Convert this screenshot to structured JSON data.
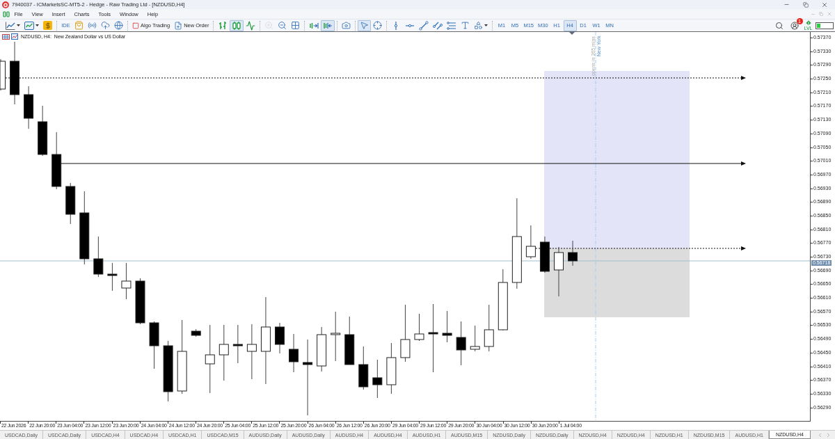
{
  "window": {
    "title": "7940037 - ICMarketsSC-MT5-2 - Hedge - Raw Trading Ltd - [NZDUSD,H4]"
  },
  "menu": [
    "File",
    "View",
    "Insert",
    "Charts",
    "Tools",
    "Window",
    "Help"
  ],
  "toolbar": {
    "ide": "IDE",
    "algo_trading": "Algo Trading",
    "new_order": "New Order",
    "chart_types": [
      {
        "selected": false
      },
      {
        "selected": true
      },
      {
        "selected": false
      }
    ],
    "zoom": [
      {
        "disabled": true
      },
      {
        "disabled": false
      }
    ],
    "auto_scroll": {
      "on": false
    },
    "chart_shift": {
      "on": true
    },
    "pointer_tools": [
      {
        "selected": true
      },
      {
        "selected": false
      }
    ],
    "timeframes": [
      {
        "label": "M1",
        "selected": false
      },
      {
        "label": "M5",
        "selected": false
      },
      {
        "label": "M15",
        "selected": false
      },
      {
        "label": "M30",
        "selected": false
      },
      {
        "label": "H1",
        "selected": false
      },
      {
        "label": "H4",
        "selected": true
      },
      {
        "label": "D1",
        "selected": false
      },
      {
        "label": "W1",
        "selected": false
      },
      {
        "label": "MN",
        "selected": false
      }
    ],
    "notification_count": "1",
    "level_label": "LVL"
  },
  "chart": {
    "title": "NZDUSD, H4:  New Zealand Dollar vs US Dollar",
    "session": {
      "name": "New York",
      "note": "opens in 265 mins"
    },
    "price_labels": [
      "0.57370",
      "0.57330",
      "0.57290",
      "0.57250",
      "0.57210",
      "0.57170",
      "0.57130",
      "0.57090",
      "0.57050",
      "0.57010",
      "0.56970",
      "0.56930",
      "0.56890",
      "0.56850",
      "0.56810",
      "0.56770",
      "0.56730",
      "0.56690",
      "0.56650",
      "0.56610",
      "0.56570",
      "0.56530",
      "0.56490",
      "0.56450",
      "0.56410",
      "0.56370",
      "0.56330",
      "0.56290"
    ],
    "current_price": "0.56718",
    "time_labels": [
      "22 Jun 2026",
      "22 Jun 20:00",
      "23 Jun 04:00",
      "23 Jun 12:00",
      "23 Jun 20:00",
      "24 Jun 04:00",
      "24 Jun 12:00",
      "24 Jun 20:00",
      "25 Jun 04:00",
      "25 Jun 12:00",
      "25 Jun 20:00",
      "26 Jun 04:00",
      "26 Jun 12:00",
      "26 Jun 20:00",
      "29 Jun 04:00",
      "29 Jun 12:00",
      "29 Jun 20:00",
      "30 Jun 04:00",
      "30 Jun 12:00",
      "30 Jun 20:00",
      "1 Jul 04:00"
    ]
  },
  "tabs": [
    {
      "label": "USDCAD,Daily",
      "selected": false
    },
    {
      "label": "USDCAD,Daily",
      "selected": false
    },
    {
      "label": "USDCAD,H4",
      "selected": false
    },
    {
      "label": "USDCAD,H4",
      "selected": false
    },
    {
      "label": "USDCAD,H1",
      "selected": false
    },
    {
      "label": "USDCAD,M15",
      "selected": false
    },
    {
      "label": "AUDUSD,Daily",
      "selected": false
    },
    {
      "label": "AUDUSD,Daily",
      "selected": false
    },
    {
      "label": "AUDUSD,H4",
      "selected": false
    },
    {
      "label": "AUDUSD,H4",
      "selected": false
    },
    {
      "label": "AUDUSD,H1",
      "selected": false
    },
    {
      "label": "AUDUSD,M15",
      "selected": false
    },
    {
      "label": "NZDUSD,Daily",
      "selected": false
    },
    {
      "label": "NZDUSD,Daily",
      "selected": false
    },
    {
      "label": "NZDUSD,H4",
      "selected": false
    },
    {
      "label": "NZDUSD,H4",
      "selected": false
    },
    {
      "label": "NZDUSD,H1",
      "selected": false
    },
    {
      "label": "NZDUSD,M15",
      "selected": false
    },
    {
      "label": "AUDUSD,H1",
      "selected": false
    },
    {
      "label": "NZDUSD,H4",
      "selected": true
    }
  ]
}
